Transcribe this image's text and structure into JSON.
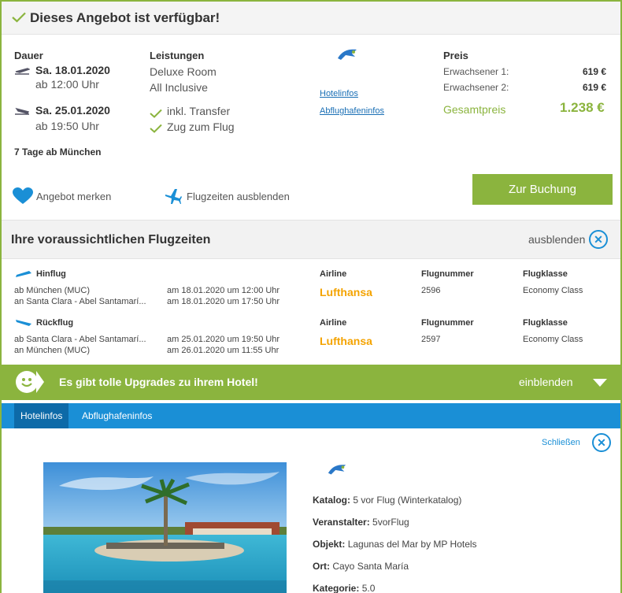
{
  "availability": {
    "title": "Dieses Angebot ist verfügbar!"
  },
  "duration": {
    "label": "Dauer",
    "outbound_date": "Sa. 18.01.2020",
    "outbound_time": "ab 12:00 Uhr",
    "return_date": "Sa. 25.01.2020",
    "return_time": "ab 19:50 Uhr",
    "summary": "7 Tage ab München"
  },
  "services": {
    "label": "Leistungen",
    "room": "Deluxe Room",
    "board": "All Inclusive",
    "transfer": "inkl. Transfer",
    "train": "Zug zum Flug"
  },
  "links": {
    "hotel_info": "Hotelinfos",
    "airport_info": "Abflughafeninfos"
  },
  "price": {
    "label": "Preis",
    "adult1_label": "Erwachsener 1:",
    "adult1_value": "619 €",
    "adult2_label": "Erwachsener 2:",
    "adult2_value": "619 €",
    "total_label": "Gesamtpreis",
    "total_value": "1.238 €"
  },
  "actions": {
    "save_offer": "Angebot merken",
    "hide_flights": "Flugzeiten ausblenden",
    "book": "Zur Buchung"
  },
  "flights": {
    "title": "Ihre voraussichtlichen Flugzeiten",
    "hide": "ausblenden",
    "col_airline": "Airline",
    "col_number": "Flugnummer",
    "col_class": "Flugklasse",
    "outbound": {
      "label": "Hinflug",
      "from": "ab München (MUC)",
      "to": "an Santa Clara - Abel Santamarí...",
      "dep": "am 18.01.2020 um 12:00 Uhr",
      "arr": "am 18.01.2020 um 17:50 Uhr",
      "airline": "Lufthansa",
      "number": "2596",
      "class": "Economy Class"
    },
    "return": {
      "label": "Rückflug",
      "from": "ab Santa Clara - Abel Santamarí...",
      "to": "an München (MUC)",
      "dep": "am 25.01.2020 um 19:50 Uhr",
      "arr": "am 26.01.2020 um 11:55 Uhr",
      "airline": "Lufthansa",
      "number": "2597",
      "class": "Economy Class"
    }
  },
  "upgrades": {
    "text": "Es gibt tolle Upgrades zu ihrem Hotel!",
    "show": "einblenden"
  },
  "info_tabs": {
    "tab1": "Hotelinfos",
    "tab2": "Abflughafeninfos",
    "close": "Schließen"
  },
  "hotel": {
    "catalog_label": "Katalog:",
    "catalog": "5 vor Flug (Winterkatalog)",
    "operator_label": "Veranstalter:",
    "operator": "5vorFlug",
    "object_label": "Objekt:",
    "object": "Lagunas del Mar by MP Hotels",
    "location_label": "Ort:",
    "location": "Cayo Santa María",
    "category_label": "Kategorie:",
    "category": "5.0"
  },
  "colors": {
    "accent_green": "#8bb43e",
    "accent_blue": "#1a8fd6",
    "lufthansa": "#f4a300"
  }
}
